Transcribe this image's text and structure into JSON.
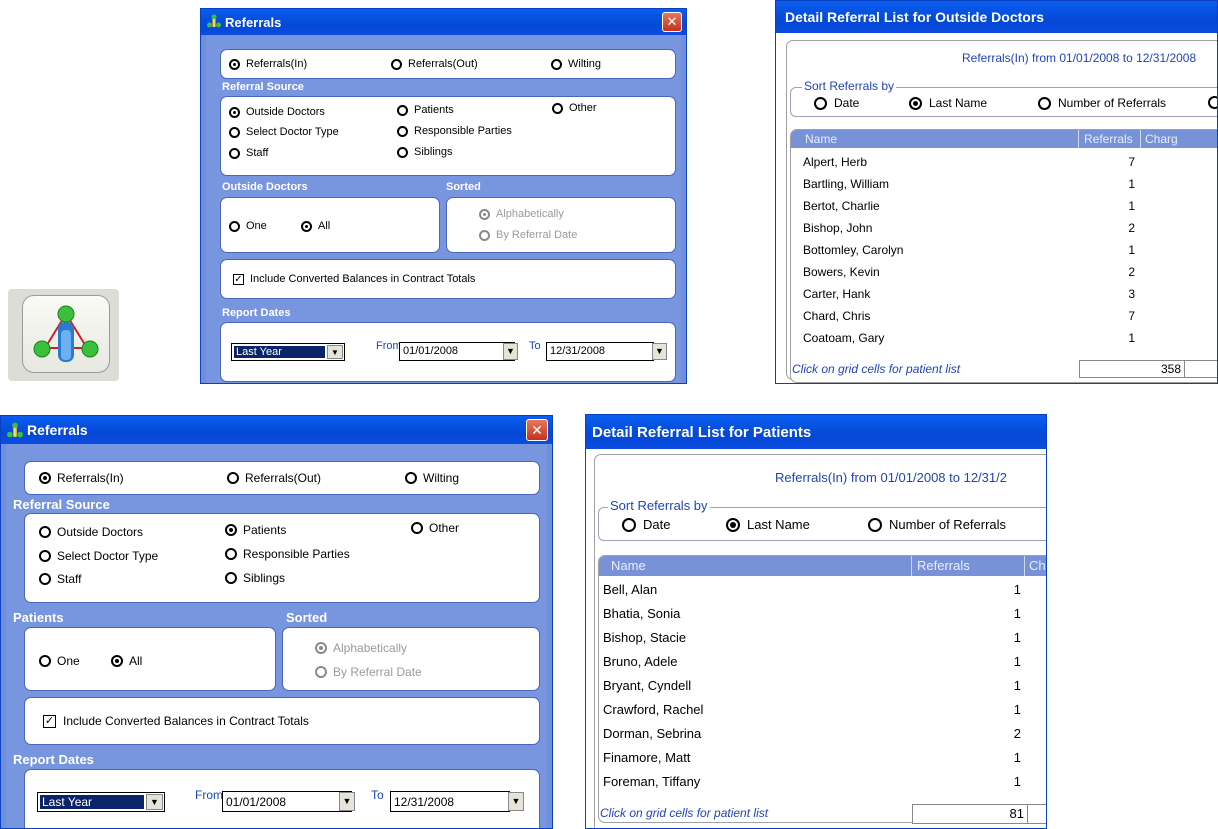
{
  "referrals_dialog": {
    "title": "Referrals",
    "close_label": "✕",
    "direction_options": [
      "Referrals(In)",
      "Referrals(Out)",
      "Wilting"
    ],
    "source_header": "Referral Source",
    "source_options": {
      "outside_doctors": "Outside Doctors",
      "select_doctor_type": "Select Doctor Type",
      "staff": "Staff",
      "patients": "Patients",
      "responsible_parties": "Responsible Parties",
      "siblings": "Siblings",
      "other": "Other"
    },
    "sorted_header": "Sorted",
    "one_label": "One",
    "all_label": "All",
    "sort_alpha": "Alphabetically",
    "sort_refdate": "By Referral Date",
    "include_converted": "Include Converted Balances in Contract Totals",
    "report_dates_header": "Report Dates",
    "range_value": "Last Year",
    "from_label": "From",
    "from_value": "01/01/2008",
    "to_label": "To",
    "to_value": "12/31/2008"
  },
  "dialog_top": {
    "scope_header": "Outside Doctors"
  },
  "dialog_bottom": {
    "scope_header": "Patients"
  },
  "list_doctors": {
    "title": "Detail Referral List for Outside Doctors",
    "range_text": "Referrals(In) from 01/01/2008 to 12/31/2008",
    "sort_by_label": "Sort Referrals by",
    "sort_options": [
      "Date",
      "Last Name",
      "Number of Referrals"
    ],
    "columns": [
      "Name",
      "Referrals",
      "Charg"
    ],
    "rows": [
      {
        "name": "Alpert, Herb",
        "referrals": "7"
      },
      {
        "name": "Bartling, William",
        "referrals": "1"
      },
      {
        "name": "Bertot, Charlie",
        "referrals": "1"
      },
      {
        "name": "Bishop, John",
        "referrals": "2"
      },
      {
        "name": "Bottomley, Carolyn",
        "referrals": "1"
      },
      {
        "name": "Bowers, Kevin",
        "referrals": "2"
      },
      {
        "name": "Carter, Hank",
        "referrals": "3"
      },
      {
        "name": "Chard, Chris",
        "referrals": "7"
      },
      {
        "name": "Coatoam, Gary",
        "referrals": "1"
      }
    ],
    "hint": "Click on grid cells for patient list",
    "total": "358"
  },
  "list_patients": {
    "title": "Detail Referral List for Patients",
    "range_text": "Referrals(In) from 01/01/2008 to 12/31/2",
    "sort_by_label": "Sort Referrals by",
    "sort_options": [
      "Date",
      "Last Name",
      "Number of Referrals"
    ],
    "columns": [
      "Name",
      "Referrals",
      "Ch"
    ],
    "rows": [
      {
        "name": "Bell, Alan",
        "referrals": "1"
      },
      {
        "name": "Bhatia, Sonia",
        "referrals": "1"
      },
      {
        "name": "Bishop, Stacie",
        "referrals": "1"
      },
      {
        "name": "Bruno, Adele",
        "referrals": "1"
      },
      {
        "name": "Bryant, Cyndell",
        "referrals": "1"
      },
      {
        "name": "Crawford, Rachel",
        "referrals": "1"
      },
      {
        "name": "Dorman, Sebrina",
        "referrals": "2"
      },
      {
        "name": "Finamore, Matt",
        "referrals": "1"
      },
      {
        "name": "Foreman, Tiffany",
        "referrals": "1"
      }
    ],
    "hint": "Click on grid cells for patient list",
    "total": "81"
  },
  "colors": {
    "titlebar": "#0548d6",
    "dialog_body": "#7895df",
    "grid_header": "#7892d8",
    "link_text": "#2244bb"
  }
}
